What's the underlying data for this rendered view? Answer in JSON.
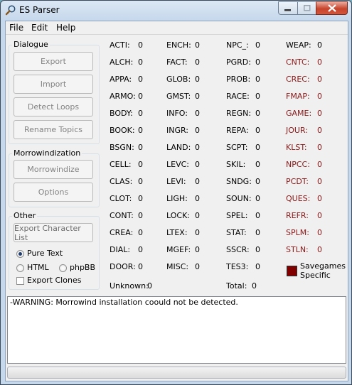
{
  "window": {
    "title": "ES Parser"
  },
  "menu": [
    "File",
    "Edit",
    "Help"
  ],
  "dialogue": {
    "group_label": "Dialogue",
    "buttons": [
      "Export",
      "Import",
      "Detect Loops",
      "Rename Topics"
    ]
  },
  "morrowindization": {
    "group_label": "Morrowindization",
    "buttons": [
      "Morrowindize",
      "Options"
    ]
  },
  "other": {
    "group_label": "Other",
    "export_char_list": "Export Character List",
    "format_options": [
      "Pure Text",
      "HTML",
      "phpBB"
    ],
    "selected_format": "Pure Text",
    "export_clones_label": "Export Clones",
    "export_clones_checked": false
  },
  "records": {
    "col1": [
      {
        "code": "ACTI:",
        "count": "0"
      },
      {
        "code": "ALCH:",
        "count": "0"
      },
      {
        "code": "APPA:",
        "count": "0"
      },
      {
        "code": "ARMO:",
        "count": "0"
      },
      {
        "code": "BODY:",
        "count": "0"
      },
      {
        "code": "BOOK:",
        "count": "0"
      },
      {
        "code": "BSGN:",
        "count": "0"
      },
      {
        "code": "CELL:",
        "count": "0"
      },
      {
        "code": "CLAS:",
        "count": "0"
      },
      {
        "code": "CLOT:",
        "count": "0"
      },
      {
        "code": "CONT:",
        "count": "0"
      },
      {
        "code": "CREA:",
        "count": "0"
      },
      {
        "code": "DIAL:",
        "count": "0"
      },
      {
        "code": "DOOR:",
        "count": "0"
      }
    ],
    "col2": [
      {
        "code": "ENCH:",
        "count": "0"
      },
      {
        "code": "FACT:",
        "count": "0"
      },
      {
        "code": "GLOB:",
        "count": "0"
      },
      {
        "code": "GMST:",
        "count": "0"
      },
      {
        "code": "INFO:",
        "count": "0"
      },
      {
        "code": "INGR:",
        "count": "0"
      },
      {
        "code": "LAND:",
        "count": "0"
      },
      {
        "code": "LEVC:",
        "count": "0"
      },
      {
        "code": "LEVI:",
        "count": "0"
      },
      {
        "code": "LIGH:",
        "count": "0"
      },
      {
        "code": "LOCK:",
        "count": "0"
      },
      {
        "code": "LTEX:",
        "count": "0"
      },
      {
        "code": "MGEF:",
        "count": "0"
      },
      {
        "code": "MISC:",
        "count": "0"
      }
    ],
    "col3": [
      {
        "code": "NPC_:",
        "count": "0"
      },
      {
        "code": "PGRD:",
        "count": "0"
      },
      {
        "code": "PROB:",
        "count": "0"
      },
      {
        "code": "RACE:",
        "count": "0"
      },
      {
        "code": "REGN:",
        "count": "0"
      },
      {
        "code": "REPA:",
        "count": "0"
      },
      {
        "code": "SCPT:",
        "count": "0"
      },
      {
        "code": "SKIL:",
        "count": "0"
      },
      {
        "code": "SNDG:",
        "count": "0"
      },
      {
        "code": "SOUN:",
        "count": "0"
      },
      {
        "code": "SPEL:",
        "count": "0"
      },
      {
        "code": "STAT:",
        "count": "0"
      },
      {
        "code": "SSCR:",
        "count": "0"
      },
      {
        "code": "TES3:",
        "count": "0"
      }
    ],
    "col4": [
      {
        "code": "WEAP:",
        "count": "0"
      },
      {
        "code": "CNTC:",
        "count": "0"
      },
      {
        "code": "CREC:",
        "count": "0"
      },
      {
        "code": "FMAP:",
        "count": "0"
      },
      {
        "code": "GAME:",
        "count": "0"
      },
      {
        "code": "JOUR:",
        "count": "0"
      },
      {
        "code": "KLST:",
        "count": "0"
      },
      {
        "code": "NPCC:",
        "count": "0"
      },
      {
        "code": "PCDT:",
        "count": "0"
      },
      {
        "code": "QUES:",
        "count": "0"
      },
      {
        "code": "REFR:",
        "count": "0"
      },
      {
        "code": "SPLM:",
        "count": "0"
      },
      {
        "code": "STLN:",
        "count": "0"
      }
    ],
    "unknown_label": "Unknown:",
    "unknown_count": "0",
    "total_label": "Total:",
    "total_count": "0",
    "legend_label_1": "Savegames",
    "legend_label_2": "Specific",
    "legend_color": "#800000"
  },
  "log": {
    "text": "-WARNING: Morrowind installation coould not be detected."
  },
  "status": {
    "progress": 0
  }
}
